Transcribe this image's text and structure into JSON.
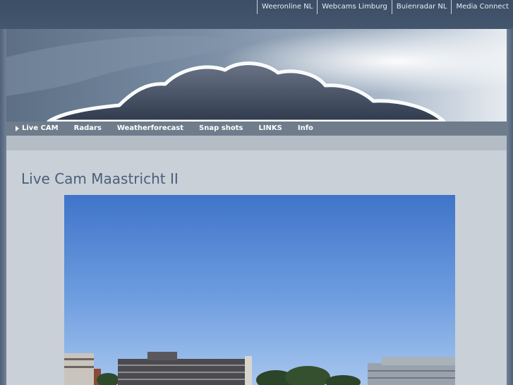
{
  "header": {
    "links": [
      {
        "label": "Weeronline NL"
      },
      {
        "label": "Webcams Limburg"
      },
      {
        "label": "Buienradar NL"
      },
      {
        "label": "Media Connect"
      }
    ]
  },
  "nav": {
    "items": [
      {
        "label": "Live CAM",
        "active": true
      },
      {
        "label": "Radars"
      },
      {
        "label": "Weatherforecast"
      },
      {
        "label": "Snap shots"
      },
      {
        "label": "LINKS"
      },
      {
        "label": "Info"
      }
    ]
  },
  "main": {
    "title": "Live Cam Maastricht II"
  },
  "colors": {
    "topbar": "#3b4e66",
    "nav": "#6e7c8b",
    "content_bg": "#c9d0d8",
    "title": "#4a5f7a",
    "sky": "#5d8ed8"
  }
}
